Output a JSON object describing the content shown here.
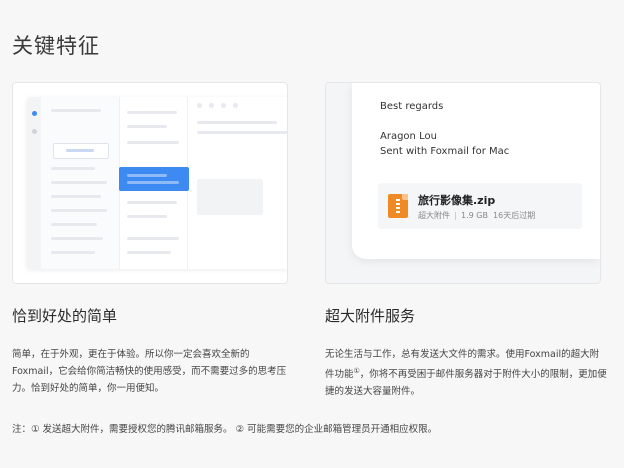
{
  "page": {
    "title": "关键特征"
  },
  "card_right": {
    "regards": "Best regards",
    "name": "Aragon Lou",
    "sent_with": "Sent with  Foxmail for Mac",
    "attachment": {
      "file_name": "旅行影像集.zip",
      "type_label": "超大附件",
      "size": "1.9 GB",
      "expires": "16天后过期",
      "icon": "zip-file-icon",
      "icon_color": "#f08a24"
    }
  },
  "features": [
    {
      "title": "恰到好处的简单",
      "desc": "简单，在于外观，更在于体验。所以你一定会喜欢全新的Foxmail，它会给你简洁畅快的使用感受，而不需要过多的思考压力。恰到好处的简单，你一用便知。"
    },
    {
      "title": "超大附件服务",
      "desc_part1": "无论生活与工作，总有发送大文件的需求。使用Foxmail的超大附件功能",
      "desc_sup": "①",
      "desc_part2": "，你将不再受困于邮件服务器对于附件大小的限制，更加便捷的发送大容量附件。"
    }
  ],
  "footnote": "注：① 发送超大附件，需要授权您的腾讯邮箱服务。   ② 可能需要您的企业邮箱管理员开通相应权限。",
  "colors": {
    "accent": "#3d8bf2",
    "background": "#f7f7f8"
  }
}
